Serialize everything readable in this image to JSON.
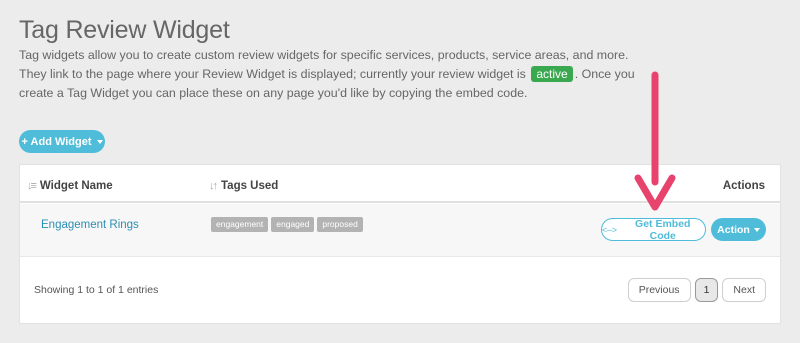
{
  "header": {
    "title": "Tag Review Widget",
    "description_part1": "Tag widgets allow you to create custom review widgets for specific services, products, service areas, and more. They link to the page where your Review Widget is displayed; currently your review widget is",
    "status_badge": "active",
    "description_part2": ". Once you create a Tag Widget you can place these on any page you'd like by copying the embed code."
  },
  "toolbar": {
    "add_widget_label": "+ Add Widget"
  },
  "table": {
    "columns": {
      "widget_name": "Widget Name",
      "tags_used": "Tags Used",
      "actions": "Actions"
    },
    "rows": [
      {
        "name": "Engagement Rings",
        "tags": [
          "engagement",
          "engaged",
          "proposed"
        ],
        "embed_label": "Get Embed Code",
        "embed_icon": "<-->",
        "action_label": "Action"
      }
    ],
    "info": "Showing 1 to 1 of 1 entries"
  },
  "pagination": {
    "previous": "Previous",
    "current_page": "1",
    "next": "Next"
  },
  "colors": {
    "accent": "#4fbcd9",
    "active_badge": "#3aa84f",
    "link": "#2c8fb3",
    "annotation_arrow": "#e8436d"
  }
}
